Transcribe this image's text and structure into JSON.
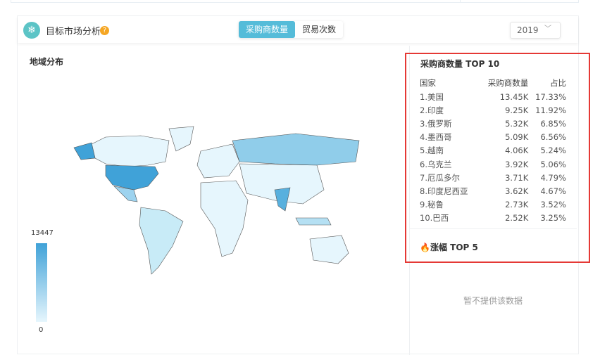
{
  "header": {
    "title": "目标市场分析",
    "help_icon": "question-icon",
    "tabs": [
      {
        "label": "采购商数量",
        "active": true
      },
      {
        "label": "贸易次数",
        "active": false
      }
    ],
    "year": "2019"
  },
  "map": {
    "section_title": "地域分布",
    "legend_max": "13447",
    "legend_min": "0",
    "colors": {
      "max": "#40a2d8",
      "min": "#e6f6fd"
    }
  },
  "top10": {
    "title": "采购商数量 TOP 10",
    "columns": [
      "国家",
      "采购商数量",
      "占比"
    ],
    "rows": [
      [
        "1.美国",
        "13.45K",
        "17.33%"
      ],
      [
        "2.印度",
        "9.25K",
        "11.92%"
      ],
      [
        "3.俄罗斯",
        "5.32K",
        "6.85%"
      ],
      [
        "4.墨西哥",
        "5.09K",
        "6.56%"
      ],
      [
        "5.越南",
        "4.06K",
        "5.24%"
      ],
      [
        "6.乌克兰",
        "3.92K",
        "5.06%"
      ],
      [
        "7.厄瓜多尔",
        "3.71K",
        "4.79%"
      ],
      [
        "8.印度尼西亚",
        "3.62K",
        "4.67%"
      ],
      [
        "9.秘鲁",
        "2.73K",
        "3.52%"
      ],
      [
        "10.巴西",
        "2.52K",
        "3.25%"
      ]
    ]
  },
  "top5": {
    "title": "涨幅 TOP 5",
    "icon": "fire-icon",
    "empty": "暂不提供该数据"
  },
  "accent": "#55bcd9"
}
